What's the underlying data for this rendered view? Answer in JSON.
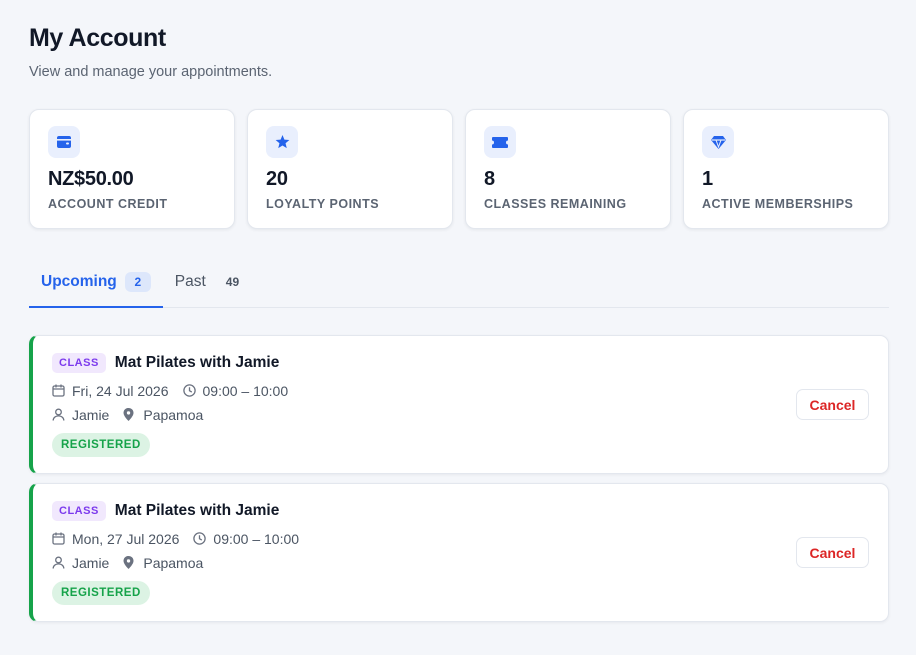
{
  "header": {
    "title": "My Account",
    "subtitle": "View and manage your appointments."
  },
  "stats": [
    {
      "icon": "wallet-icon",
      "value": "NZ$50.00",
      "label": "ACCOUNT CREDIT"
    },
    {
      "icon": "star-icon",
      "value": "20",
      "label": "LOYALTY POINTS"
    },
    {
      "icon": "ticket-icon",
      "value": "8",
      "label": "CLASSES REMAINING"
    },
    {
      "icon": "diamond-icon",
      "value": "1",
      "label": "ACTIVE MEMBERSHIPS"
    }
  ],
  "tabs": [
    {
      "label": "Upcoming",
      "count": "2",
      "active": true
    },
    {
      "label": "Past",
      "count": "49",
      "active": false
    }
  ],
  "appointments": [
    {
      "type": "CLASS",
      "title": "Mat Pilates with Jamie",
      "date": "Fri, 24 Jul 2026",
      "time": "09:00 – 10:00",
      "instructor": "Jamie",
      "location": "Papamoa",
      "status": "REGISTERED",
      "action": "Cancel"
    },
    {
      "type": "CLASS",
      "title": "Mat Pilates with Jamie",
      "date": "Mon, 27 Jul 2026",
      "time": "09:00 – 10:00",
      "instructor": "Jamie",
      "location": "Papamoa",
      "status": "REGISTERED",
      "action": "Cancel"
    }
  ],
  "colors": {
    "accent": "#2563eb",
    "success": "#16a34a",
    "danger": "#dc2626",
    "class_badge": "#7c3aed"
  }
}
